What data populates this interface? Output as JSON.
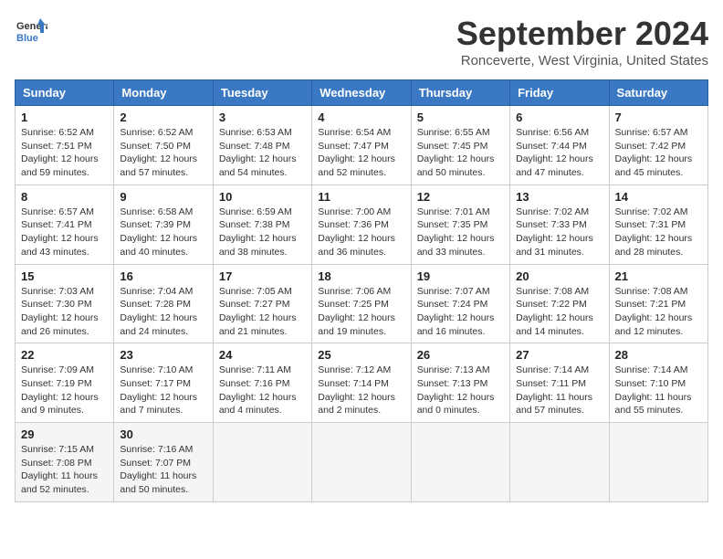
{
  "header": {
    "logo_line1": "General",
    "logo_line2": "Blue",
    "month": "September 2024",
    "location": "Ronceverte, West Virginia, United States"
  },
  "days_of_week": [
    "Sunday",
    "Monday",
    "Tuesday",
    "Wednesday",
    "Thursday",
    "Friday",
    "Saturday"
  ],
  "weeks": [
    [
      {
        "day": "1",
        "info": "Sunrise: 6:52 AM\nSunset: 7:51 PM\nDaylight: 12 hours\nand 59 minutes."
      },
      {
        "day": "2",
        "info": "Sunrise: 6:52 AM\nSunset: 7:50 PM\nDaylight: 12 hours\nand 57 minutes."
      },
      {
        "day": "3",
        "info": "Sunrise: 6:53 AM\nSunset: 7:48 PM\nDaylight: 12 hours\nand 54 minutes."
      },
      {
        "day": "4",
        "info": "Sunrise: 6:54 AM\nSunset: 7:47 PM\nDaylight: 12 hours\nand 52 minutes."
      },
      {
        "day": "5",
        "info": "Sunrise: 6:55 AM\nSunset: 7:45 PM\nDaylight: 12 hours\nand 50 minutes."
      },
      {
        "day": "6",
        "info": "Sunrise: 6:56 AM\nSunset: 7:44 PM\nDaylight: 12 hours\nand 47 minutes."
      },
      {
        "day": "7",
        "info": "Sunrise: 6:57 AM\nSunset: 7:42 PM\nDaylight: 12 hours\nand 45 minutes."
      }
    ],
    [
      {
        "day": "8",
        "info": "Sunrise: 6:57 AM\nSunset: 7:41 PM\nDaylight: 12 hours\nand 43 minutes."
      },
      {
        "day": "9",
        "info": "Sunrise: 6:58 AM\nSunset: 7:39 PM\nDaylight: 12 hours\nand 40 minutes."
      },
      {
        "day": "10",
        "info": "Sunrise: 6:59 AM\nSunset: 7:38 PM\nDaylight: 12 hours\nand 38 minutes."
      },
      {
        "day": "11",
        "info": "Sunrise: 7:00 AM\nSunset: 7:36 PM\nDaylight: 12 hours\nand 36 minutes."
      },
      {
        "day": "12",
        "info": "Sunrise: 7:01 AM\nSunset: 7:35 PM\nDaylight: 12 hours\nand 33 minutes."
      },
      {
        "day": "13",
        "info": "Sunrise: 7:02 AM\nSunset: 7:33 PM\nDaylight: 12 hours\nand 31 minutes."
      },
      {
        "day": "14",
        "info": "Sunrise: 7:02 AM\nSunset: 7:31 PM\nDaylight: 12 hours\nand 28 minutes."
      }
    ],
    [
      {
        "day": "15",
        "info": "Sunrise: 7:03 AM\nSunset: 7:30 PM\nDaylight: 12 hours\nand 26 minutes."
      },
      {
        "day": "16",
        "info": "Sunrise: 7:04 AM\nSunset: 7:28 PM\nDaylight: 12 hours\nand 24 minutes."
      },
      {
        "day": "17",
        "info": "Sunrise: 7:05 AM\nSunset: 7:27 PM\nDaylight: 12 hours\nand 21 minutes."
      },
      {
        "day": "18",
        "info": "Sunrise: 7:06 AM\nSunset: 7:25 PM\nDaylight: 12 hours\nand 19 minutes."
      },
      {
        "day": "19",
        "info": "Sunrise: 7:07 AM\nSunset: 7:24 PM\nDaylight: 12 hours\nand 16 minutes."
      },
      {
        "day": "20",
        "info": "Sunrise: 7:08 AM\nSunset: 7:22 PM\nDaylight: 12 hours\nand 14 minutes."
      },
      {
        "day": "21",
        "info": "Sunrise: 7:08 AM\nSunset: 7:21 PM\nDaylight: 12 hours\nand 12 minutes."
      }
    ],
    [
      {
        "day": "22",
        "info": "Sunrise: 7:09 AM\nSunset: 7:19 PM\nDaylight: 12 hours\nand 9 minutes."
      },
      {
        "day": "23",
        "info": "Sunrise: 7:10 AM\nSunset: 7:17 PM\nDaylight: 12 hours\nand 7 minutes."
      },
      {
        "day": "24",
        "info": "Sunrise: 7:11 AM\nSunset: 7:16 PM\nDaylight: 12 hours\nand 4 minutes."
      },
      {
        "day": "25",
        "info": "Sunrise: 7:12 AM\nSunset: 7:14 PM\nDaylight: 12 hours\nand 2 minutes."
      },
      {
        "day": "26",
        "info": "Sunrise: 7:13 AM\nSunset: 7:13 PM\nDaylight: 12 hours\nand 0 minutes."
      },
      {
        "day": "27",
        "info": "Sunrise: 7:14 AM\nSunset: 7:11 PM\nDaylight: 11 hours\nand 57 minutes."
      },
      {
        "day": "28",
        "info": "Sunrise: 7:14 AM\nSunset: 7:10 PM\nDaylight: 11 hours\nand 55 minutes."
      }
    ],
    [
      {
        "day": "29",
        "info": "Sunrise: 7:15 AM\nSunset: 7:08 PM\nDaylight: 11 hours\nand 52 minutes."
      },
      {
        "day": "30",
        "info": "Sunrise: 7:16 AM\nSunset: 7:07 PM\nDaylight: 11 hours\nand 50 minutes."
      },
      {
        "day": "",
        "info": ""
      },
      {
        "day": "",
        "info": ""
      },
      {
        "day": "",
        "info": ""
      },
      {
        "day": "",
        "info": ""
      },
      {
        "day": "",
        "info": ""
      }
    ]
  ]
}
